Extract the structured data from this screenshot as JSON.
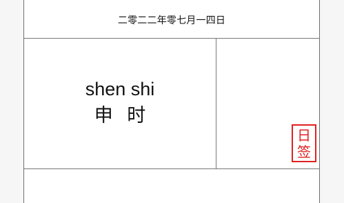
{
  "calendar": {
    "date_text": "二零二二年零七月一四日",
    "period_pinyin": "shen shi",
    "period_hanzi": "申 时",
    "stamp_line1": "日",
    "stamp_line2": "签"
  },
  "colors": {
    "stamp": "#e02020",
    "border": "#777777",
    "background": "#f6f6f6",
    "card": "#ffffff"
  }
}
